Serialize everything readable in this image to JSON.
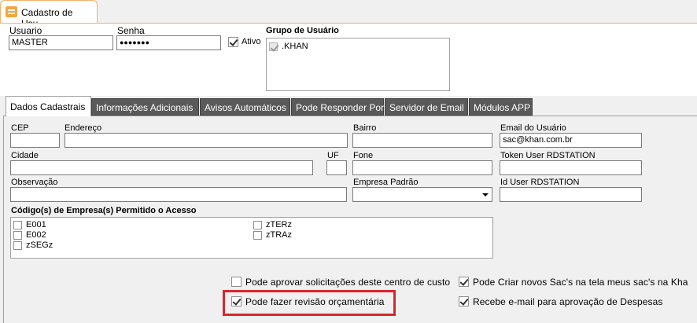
{
  "window": {
    "tab_title": "Cadastro de Usu..."
  },
  "header": {
    "usuario_label": "Usuario",
    "usuario_value": "MASTER",
    "senha_label": "Senha",
    "senha_value": "●●●●●●●",
    "ativo_label": "Ativo",
    "ativo_checked": true,
    "grupo_label": "Grupo de Usuário",
    "grupo_items": [
      {
        "label": ".KHAN",
        "checked": true
      }
    ]
  },
  "tabs": [
    {
      "label": "Dados Cadastrais",
      "active": true
    },
    {
      "label": "Informações Adicionais",
      "active": false
    },
    {
      "label": "Avisos Automáticos",
      "active": false
    },
    {
      "label": "Pode Responder Por",
      "active": false
    },
    {
      "label": "Servidor de Email",
      "active": false
    },
    {
      "label": "Módulos APP",
      "active": false
    }
  ],
  "form": {
    "cep_label": "CEP",
    "cep_value": "",
    "endereco_label": "Endereço",
    "endereco_value": "",
    "bairro_label": "Bairro",
    "bairro_value": "",
    "email_label": "Email do Usuário",
    "email_value": "sac@khan.com.br",
    "cidade_label": "Cidade",
    "cidade_value": "",
    "uf_label": "UF",
    "uf_value": "",
    "fone_label": "Fone",
    "fone_value": "",
    "token_label": "Token User RDSTATION",
    "token_value": "",
    "observacao_label": "Observação",
    "observacao_value": "",
    "empresa_label": "Empresa Padrão",
    "empresa_value": "",
    "idrd_label": "Id User RDSTATION",
    "idrd_value": ""
  },
  "empresas": {
    "label": "Código(s) de Empresa(s) Permitido o Acesso",
    "items": [
      "E001",
      "E002",
      "zSEGz",
      "zTERz",
      "zTRAz"
    ]
  },
  "options": {
    "aprovar_solicitacoes": {
      "label": "Pode aprovar solicitações deste centro de custo",
      "checked": false
    },
    "revisao_orcamentaria": {
      "label": "Pode fazer revisão orçamentária",
      "checked": true
    },
    "criar_sacs": {
      "label": "Pode Criar novos Sac's na tela meus sac's na Kha",
      "checked": true
    },
    "email_despesas": {
      "label": "Recebe e-mail para aprovação de Despesas",
      "checked": true
    }
  },
  "colors": {
    "highlight": "#d9262c",
    "tab_inactive": "#5a5a5a",
    "doc_tab_accent": "#f3a641"
  }
}
